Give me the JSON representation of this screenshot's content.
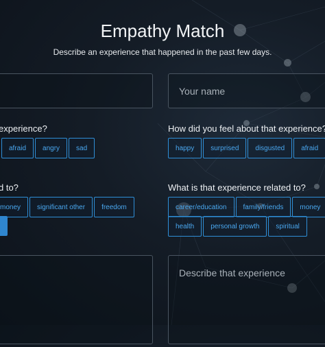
{
  "page": {
    "title": "Empathy Match",
    "subtitle": "Describe an experience that happened in the past few days."
  },
  "left": {
    "name_value": "",
    "feeling_question": "experience?",
    "feelings": [
      "afraid",
      "angry",
      "sad"
    ],
    "related_question": "d to?",
    "related_row1": [
      "money",
      "significant other",
      "freedom"
    ],
    "describe_value": ""
  },
  "right": {
    "name_placeholder": "Your name",
    "feeling_question": "How did you feel about that experience?",
    "feelings": [
      "happy",
      "surprised",
      "disgusted",
      "afraid"
    ],
    "related_question": "What is that experience related to?",
    "related_row1": [
      "career/education",
      "family/friends",
      "money"
    ],
    "related_row2": [
      "health",
      "personal growth",
      "spiritual"
    ],
    "describe_placeholder": "Describe that experience"
  },
  "colors": {
    "accent": "#2f8fd8",
    "chip_text": "#4aa8f0",
    "background": "#141c26"
  }
}
